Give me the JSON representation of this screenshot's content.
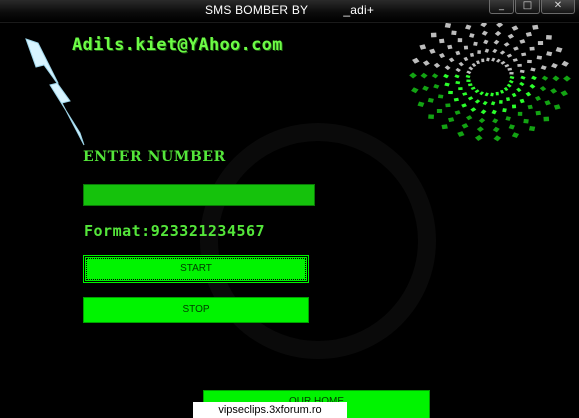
{
  "window": {
    "title": "SMS BOMBER BY          _adi+",
    "buttons": {
      "minimize": "_",
      "maximize": "□",
      "close": "✕"
    }
  },
  "header": {
    "email": "Adils.kiet@YAhoo.com"
  },
  "form": {
    "enter_label": "ENTER NUMBER",
    "number_value": "",
    "format_label": "Format:923321234567"
  },
  "buttons": {
    "start": "START",
    "stop": "STOP",
    "home": "OUR HOME"
  },
  "watermark": "vipseclips.3xforum.ro",
  "colors": {
    "background": "#000000",
    "accent": "#00f400",
    "text": "#54e63a"
  },
  "icons": [
    "lightning-bolt-icon",
    "spiral-logo-icon"
  ]
}
